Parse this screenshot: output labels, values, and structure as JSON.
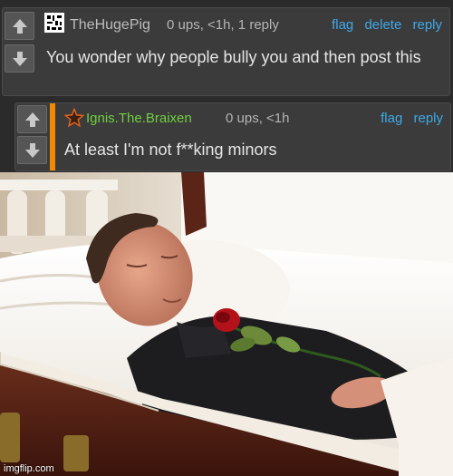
{
  "comments": [
    {
      "username": "TheHugePig",
      "stats": "0 ups, <1h, 1 reply",
      "links": [
        "flag",
        "delete",
        "reply"
      ],
      "text": "You wonder why people bully you and then post this"
    },
    {
      "username": "Ignis.The.Braixen",
      "stats": "0 ups, <1h",
      "links": [
        "flag",
        "reply"
      ],
      "text": "At least I'm not f**king minors"
    }
  ],
  "image": {
    "description": "man lying in open casket with red rose"
  },
  "watermark": "imgflip.com",
  "colors": {
    "accent_bar": "#f08a00",
    "link": "#3fa9e8",
    "username2": "#6fcf3f"
  }
}
